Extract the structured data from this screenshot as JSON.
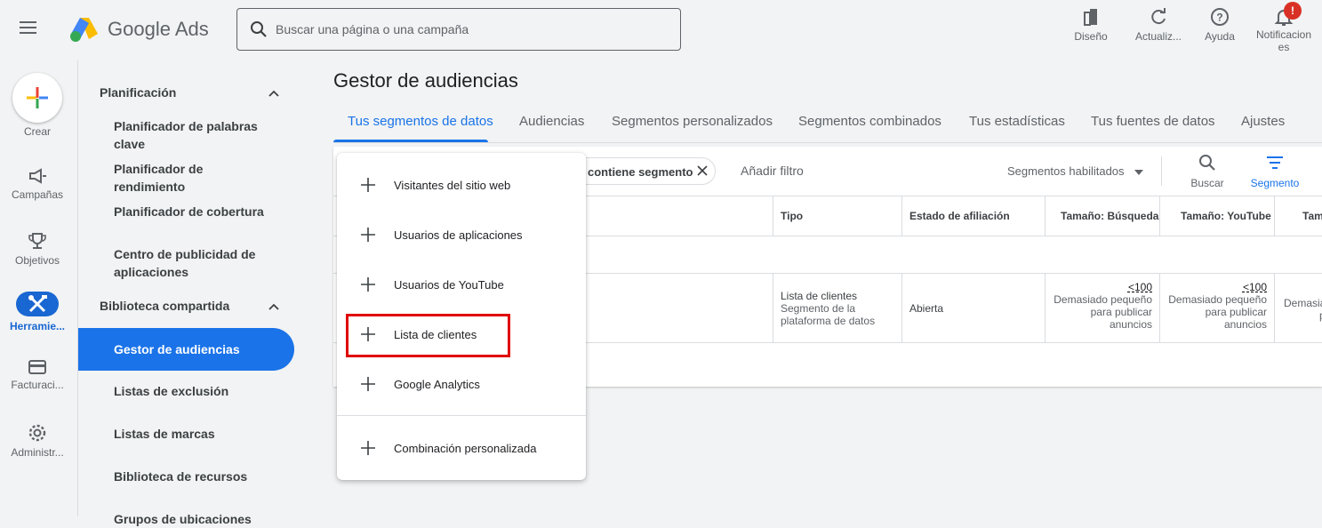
{
  "header": {
    "brand": "Google Ads",
    "search_placeholder": "Buscar una página o una campaña",
    "actions": [
      {
        "label": "Diseño",
        "icon": "appearance-icon"
      },
      {
        "label": "Actualiz...",
        "icon": "refresh-icon"
      },
      {
        "label": "Ayuda",
        "icon": "help-icon"
      },
      {
        "label": "Notificacion",
        "label2": "es",
        "icon": "bell-icon"
      }
    ],
    "notification_badge": "!"
  },
  "rail": {
    "create": "Crear",
    "items": [
      {
        "label": "Campañas",
        "icon": "megaphone-icon"
      },
      {
        "label": "Objetivos",
        "icon": "trophy-icon"
      },
      {
        "label": "Herramie...",
        "icon": "tools-icon"
      },
      {
        "label": "Facturaci...",
        "icon": "credit-card-icon"
      },
      {
        "label": "Administr...",
        "icon": "gear-icon"
      }
    ]
  },
  "sidebar": {
    "section1": "Planificación",
    "section1_items": [
      "Planificador de palabras clave",
      "Planificador de rendimiento",
      "Planificador de cobertura",
      "Centro de publicidad de aplicaciones"
    ],
    "section2": "Biblioteca compartida",
    "active_item": "Gestor de audiencias",
    "section2_items": [
      "Listas de exclusión",
      "Listas de marcas",
      "Biblioteca de recursos",
      "Grupos de ubicaciones"
    ]
  },
  "main": {
    "title": "Gestor de audiencias",
    "tabs": [
      "Tus segmentos de datos",
      "Audiencias",
      "Segmentos personalizados",
      "Segmentos combinados",
      "Tus estadísticas",
      "Tus fuentes de datos",
      "Ajustes"
    ],
    "active_tab": 0,
    "filter_chip": "contiene segmento",
    "add_filter": "Añadir filtro",
    "segments_enabled": "Segmentos habilitados",
    "search_label": "Buscar",
    "segment_label": "Segmento",
    "table": {
      "headers": [
        "Tipo",
        "Estado de afiliación",
        "Tamaño: Búsqueda",
        "Tamaño: YouTube",
        "Tam"
      ],
      "row": {
        "type_line1": "Lista de clientes",
        "type_line2": "Segmento de la",
        "type_line3": "plataforma de datos",
        "status": "Abierta",
        "search_size": "<100",
        "youtube_size": "<100",
        "note1": "Demasiado pequeño",
        "note2": "para publicar",
        "note3": "anuncios",
        "cut_note1": "Demasia",
        "cut_note2": "p"
      }
    }
  },
  "dropdown": {
    "items": [
      "Visitantes del sitio web",
      "Usuarios de aplicaciones",
      "Usuarios de YouTube",
      "Lista de clientes",
      "Google Analytics"
    ],
    "custom": "Combinación personalizada",
    "highlighted": "Lista de clientes"
  },
  "colors": {
    "accent": "#1a73e8",
    "highlight_border": "#e00000"
  }
}
